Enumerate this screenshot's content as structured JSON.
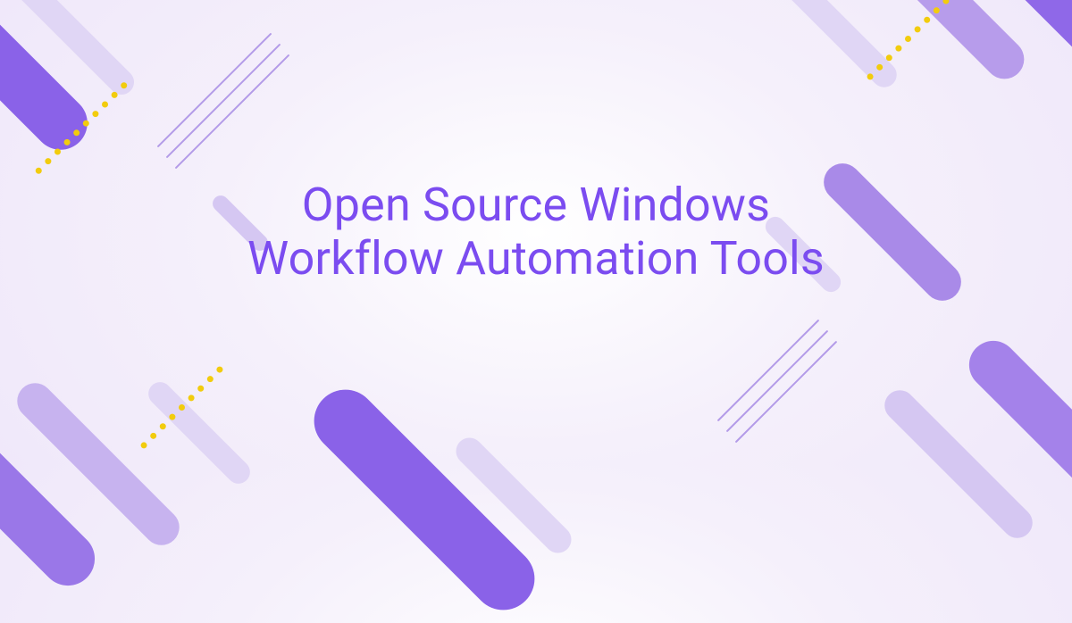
{
  "banner": {
    "title": "Open Source Windows Workflow Automation Tools",
    "colors": {
      "title": "#7b4cf0",
      "accent_dot": "#f2cc0d",
      "purple_dark": "#8a62e8",
      "purple_mid": "#a98ae8",
      "purple_light": "#d5c7f2"
    }
  }
}
